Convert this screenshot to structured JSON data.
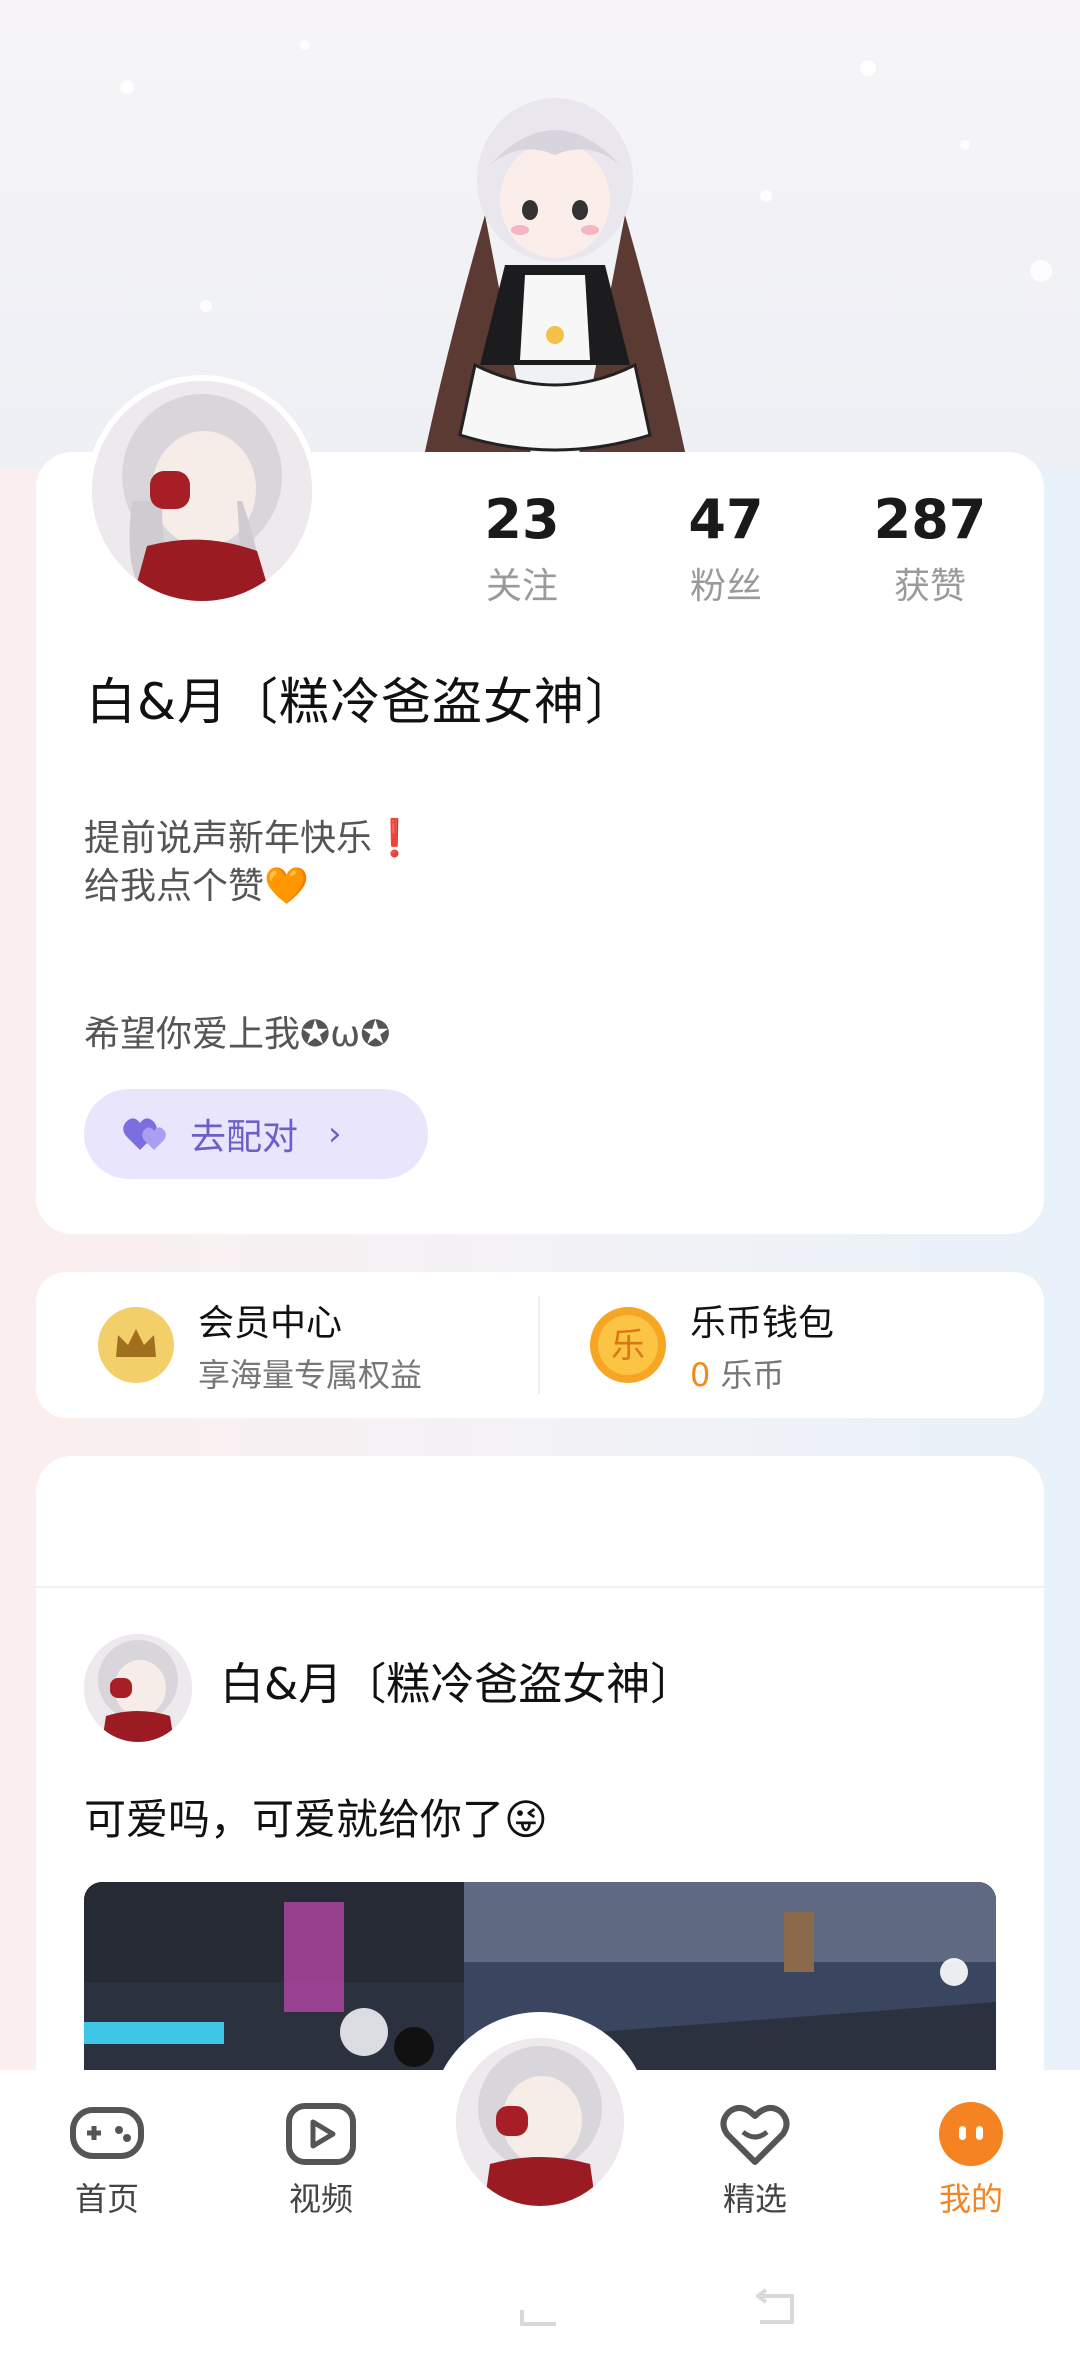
{
  "profile": {
    "nickname": "白&月〔糕冷爸盗女神〕",
    "stats": [
      {
        "value": "23",
        "label": "关注"
      },
      {
        "value": "47",
        "label": "粉丝"
      },
      {
        "value": "287",
        "label": "获赞"
      }
    ],
    "bio": {
      "line1": "提前说声新年快乐❗",
      "line2": "给我点个赞🧡",
      "line3": "希望你爱上我✪ω✪"
    },
    "pair_button": {
      "label": "去配对",
      "chevron": "›"
    }
  },
  "member": {
    "title": "会员中心",
    "subtitle": "享海量专属权益",
    "icon": "crown-icon"
  },
  "wallet": {
    "title": "乐币钱包",
    "balance": "0",
    "unit": "乐币",
    "coin_glyph": "乐"
  },
  "feed": {
    "post": {
      "author": "白&月〔糕冷爸盗女神〕",
      "text": "可爱吗，可爱就给你了😜"
    }
  },
  "nav": {
    "items": [
      {
        "label": "首页",
        "icon": "gamepad-icon"
      },
      {
        "label": "视频",
        "icon": "video-play-icon"
      },
      {
        "label": "精选",
        "icon": "heart-chat-icon"
      },
      {
        "label": "我的",
        "icon": "profile-dots-icon"
      }
    ],
    "active": "我的"
  },
  "colors": {
    "accent_orange": "#f58321",
    "pair_purple": "#6b5fc8",
    "pair_bg": "#e9e5fd",
    "crown_gold": "#f0c445"
  }
}
